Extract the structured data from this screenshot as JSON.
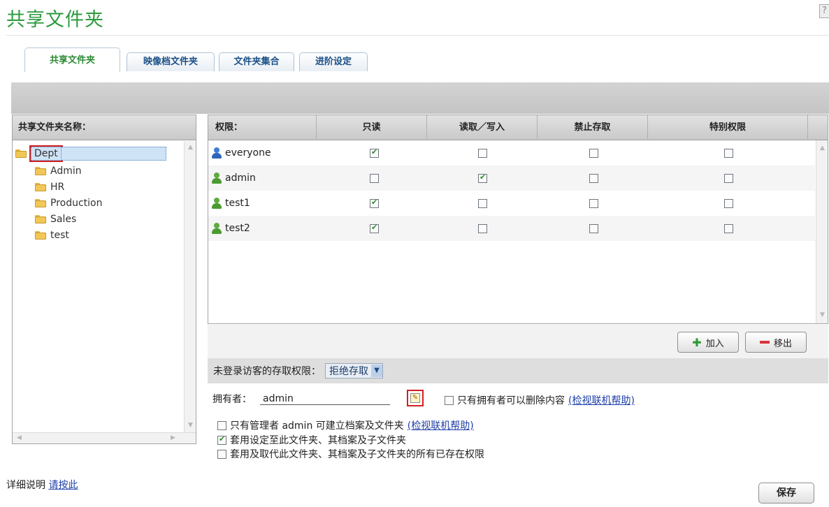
{
  "page": {
    "title": "共享文件夹",
    "help_glyph": "?"
  },
  "tabs": [
    {
      "label": "共享文件夹",
      "active": true
    },
    {
      "label": "映像档文件夹",
      "active": false
    },
    {
      "label": "文件夹集合",
      "active": false
    },
    {
      "label": "进阶设定",
      "active": false
    }
  ],
  "tree": {
    "header": "共享文件夹名称：",
    "root": "Dept",
    "children": [
      "Admin",
      "HR",
      "Production",
      "Sales",
      "test"
    ]
  },
  "permissions": {
    "headers": [
      "权限：",
      "只读",
      "读取／写入",
      "禁止存取",
      "特别权限"
    ],
    "rows": [
      {
        "user": "everyone",
        "type": "group",
        "read_only": true,
        "read_write": false,
        "deny": false,
        "special": false
      },
      {
        "user": "admin",
        "type": "user",
        "read_only": false,
        "read_write": true,
        "deny": false,
        "special": false
      },
      {
        "user": "test1",
        "type": "user",
        "read_only": true,
        "read_write": false,
        "deny": false,
        "special": false
      },
      {
        "user": "test2",
        "type": "user",
        "read_only": true,
        "read_write": false,
        "deny": false,
        "special": false
      }
    ]
  },
  "actions": {
    "add_label": "加入",
    "remove_label": "移出"
  },
  "guest": {
    "label": "未登录访客的存取权限：",
    "value": "拒绝存取"
  },
  "owner": {
    "label": "拥有者：",
    "value": "admin",
    "only_owner_delete": {
      "label": "只有拥有者可以删除内容",
      "link": "(检视联机帮助)",
      "checked": false
    }
  },
  "options": [
    {
      "label": "只有管理者 admin 可建立档案及文件夹",
      "link": "(检视联机帮助)",
      "checked": false
    },
    {
      "label": "套用设定至此文件夹、其档案及子文件夹",
      "link": "",
      "checked": true
    },
    {
      "label": "套用及取代此文件夹、其档案及子文件夹的所有已存在权限",
      "link": "",
      "checked": false
    }
  ],
  "footer": {
    "details_label": "详细说明",
    "details_link": "请按此",
    "save_label": "保存"
  },
  "colors": {
    "title_green": "#2d9a3e",
    "tab_blue": "#1a4f86",
    "highlight_red": "#d41f1f",
    "link_blue": "#1f3fa8"
  }
}
